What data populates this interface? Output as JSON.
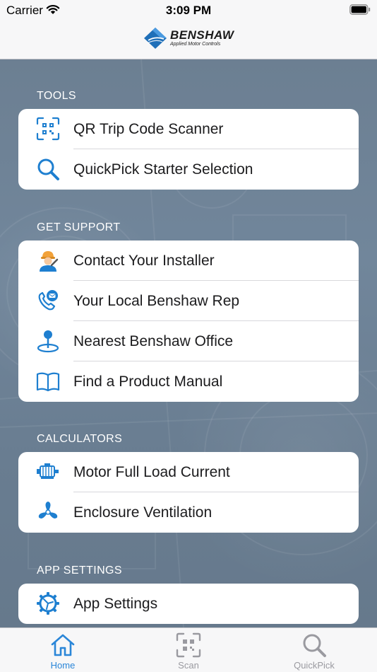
{
  "status_bar": {
    "carrier": "Carrier",
    "time": "3:09 PM"
  },
  "header": {
    "brand": "BENSHAW",
    "tagline": "Applied Motor Controls"
  },
  "sections": [
    {
      "title": "TOOLS",
      "items": [
        {
          "label": "QR Trip Code Scanner",
          "icon": "qr-scan-icon"
        },
        {
          "label": "QuickPick Starter Selection",
          "icon": "search-icon"
        }
      ]
    },
    {
      "title": "GET SUPPORT",
      "items": [
        {
          "label": "Contact Your Installer",
          "icon": "installer-icon"
        },
        {
          "label": "Your Local Benshaw Rep",
          "icon": "phone-mail-icon"
        },
        {
          "label": "Nearest Benshaw Office",
          "icon": "location-pin-icon"
        },
        {
          "label": "Find a Product Manual",
          "icon": "book-icon"
        }
      ]
    },
    {
      "title": "CALCULATORS",
      "items": [
        {
          "label": "Motor Full Load Current",
          "icon": "motor-icon"
        },
        {
          "label": "Enclosure Ventilation",
          "icon": "fan-icon"
        }
      ]
    },
    {
      "title": "APP SETTINGS",
      "items": [
        {
          "label": "App Settings",
          "icon": "gear-icon"
        }
      ]
    }
  ],
  "tabbar": {
    "tabs": [
      {
        "label": "Home",
        "icon": "home-icon",
        "active": true
      },
      {
        "label": "Scan",
        "icon": "qr-scan-icon",
        "active": false
      },
      {
        "label": "QuickPick",
        "icon": "search-icon",
        "active": false
      }
    ]
  },
  "colors": {
    "accent": "#1e7fd0",
    "tab_active": "#2a86d8",
    "tab_inactive": "#9a9aa0",
    "background": "#6f8296",
    "card": "#ffffff"
  }
}
